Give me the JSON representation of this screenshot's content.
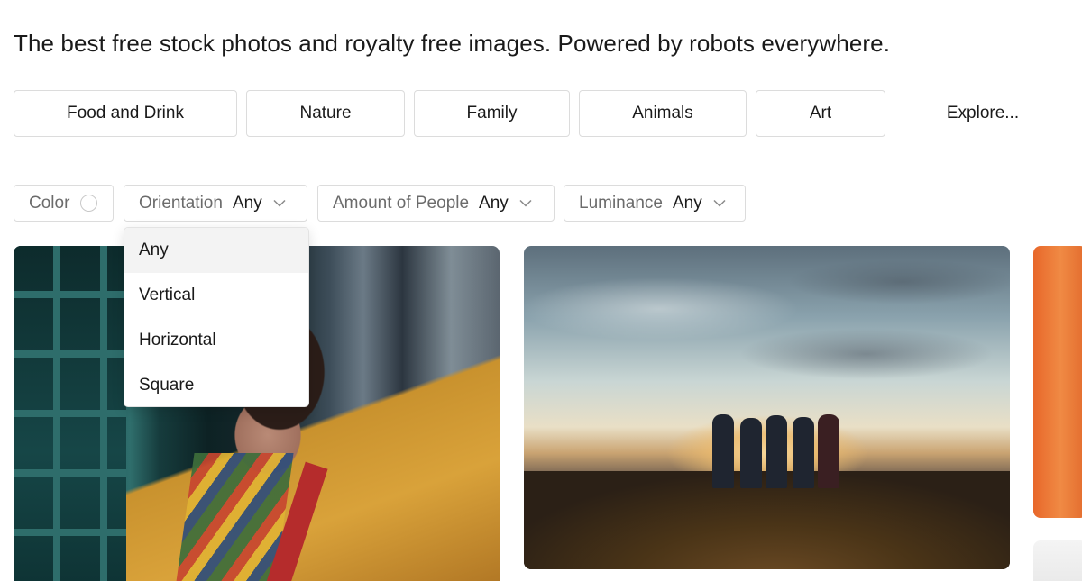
{
  "headline": "The best free stock photos and royalty free images. Powered by robots everywhere.",
  "categories": [
    "Food and Drink",
    "Nature",
    "Family",
    "Animals",
    "Art"
  ],
  "explore_label": "Explore...",
  "filters": {
    "color_label": "Color",
    "orientation": {
      "label": "Orientation",
      "value": "Any"
    },
    "people": {
      "label": "Amount of People",
      "value": "Any"
    },
    "luminance": {
      "label": "Luminance",
      "value": "Any"
    }
  },
  "orientation_dropdown": {
    "options": [
      "Any",
      "Vertical",
      "Horizontal",
      "Square"
    ],
    "selected": "Any"
  },
  "icons": {
    "chevron": "chevron-down-icon",
    "color": "color-circle-icon"
  }
}
